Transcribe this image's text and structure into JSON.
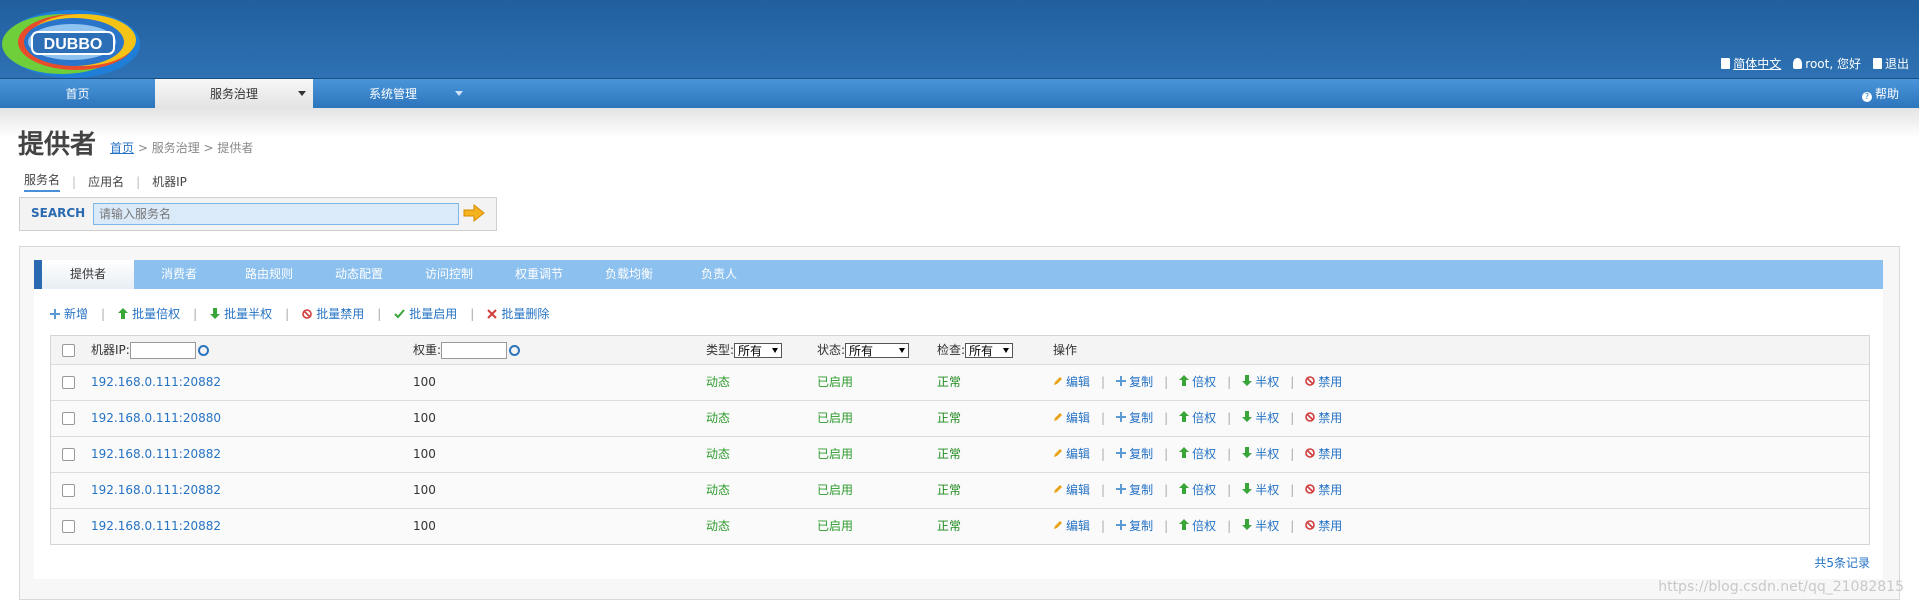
{
  "header": {
    "logo_text": "DUBBO",
    "lang": "简体中文",
    "user": "root, 您好",
    "logout": "退出"
  },
  "nav": {
    "items": [
      "首页",
      "服务治理",
      "系统管理"
    ],
    "help": "帮助"
  },
  "page": {
    "title": "提供者",
    "breadcrumb": {
      "home": "首页",
      "sep1": " > ",
      "mid": "服务治理",
      "sep2": " > ",
      "current": "提供者"
    }
  },
  "search_tabs": [
    "服务名",
    "应用名",
    "机器IP"
  ],
  "search": {
    "label": "SEARCH",
    "placeholder": "请输入服务名"
  },
  "tabs": [
    "提供者",
    "消费者",
    "路由规则",
    "动态配置",
    "访问控制",
    "权重调节",
    "负载均衡",
    "负责人"
  ],
  "actions": [
    "新增",
    "批量倍权",
    "批量半权",
    "批量禁用",
    "批量启用",
    "批量删除"
  ],
  "table": {
    "headers": {
      "ip": "机器IP:",
      "weight": "权重:",
      "type": "类型:",
      "status": "状态:",
      "check": "检查:",
      "ops": "操作"
    },
    "filters": {
      "type": "所有",
      "status": "所有",
      "check": "所有"
    },
    "rows": [
      {
        "ip": "192.168.0.111:20882",
        "weight": "100",
        "type": "动态",
        "status": "已启用",
        "check": "正常"
      },
      {
        "ip": "192.168.0.111:20880",
        "weight": "100",
        "type": "动态",
        "status": "已启用",
        "check": "正常"
      },
      {
        "ip": "192.168.0.111:20882",
        "weight": "100",
        "type": "动态",
        "status": "已启用",
        "check": "正常"
      },
      {
        "ip": "192.168.0.111:20882",
        "weight": "100",
        "type": "动态",
        "status": "已启用",
        "check": "正常"
      },
      {
        "ip": "192.168.0.111:20882",
        "weight": "100",
        "type": "动态",
        "status": "已启用",
        "check": "正常"
      }
    ],
    "row_ops": [
      "编辑",
      "复制",
      "倍权",
      "半权",
      "禁用"
    ],
    "total": "共5条记录"
  },
  "watermark": "https://blog.csdn.net/qq_21082815",
  "colors": {
    "header": "#215f9e",
    "nav": "#2b74bd",
    "tabbar": "#8cc0ee",
    "link": "#2673c4",
    "status_green": "#2e9a2e"
  }
}
